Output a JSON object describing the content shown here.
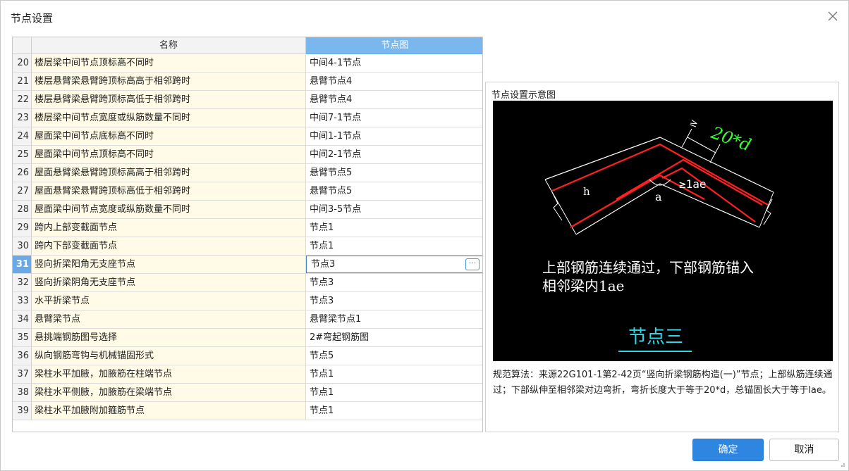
{
  "dialog": {
    "title": "节点设置"
  },
  "table": {
    "col_name": "名称",
    "col_node": "节点图",
    "selected_row": 11,
    "rows": [
      {
        "num": "20",
        "name": "楼层梁中间节点顶标高不同时",
        "node": "中间4-1节点"
      },
      {
        "num": "21",
        "name": "楼层悬臂梁悬臂跨顶标高高于相邻跨时",
        "node": "悬臂节点4"
      },
      {
        "num": "22",
        "name": "楼层悬臂梁悬臂跨顶标高低于相邻跨时",
        "node": "悬臂节点4"
      },
      {
        "num": "23",
        "name": "楼层梁中间节点宽度或纵筋数量不同时",
        "node": "中间7-1节点"
      },
      {
        "num": "24",
        "name": "屋面梁中间节点底标高不同时",
        "node": "中间1-1节点"
      },
      {
        "num": "25",
        "name": "屋面梁中间节点顶标高不同时",
        "node": "中间2-1节点"
      },
      {
        "num": "26",
        "name": "屋面悬臂梁悬臂跨顶标高高于相邻跨时",
        "node": "悬臂节点5"
      },
      {
        "num": "27",
        "name": "屋面悬臂梁悬臂跨顶标高低于相邻跨时",
        "node": "悬臂节点5"
      },
      {
        "num": "28",
        "name": "屋面梁中间节点宽度或纵筋数量不同时",
        "node": "中间3-5节点"
      },
      {
        "num": "29",
        "name": "跨内上部变截面节点",
        "node": "节点1"
      },
      {
        "num": "30",
        "name": "跨内下部变截面节点",
        "node": "节点1"
      },
      {
        "num": "31",
        "name": "竖向折梁阳角无支座节点",
        "node": "节点3"
      },
      {
        "num": "32",
        "name": "竖向折梁阴角无支座节点",
        "node": "节点3"
      },
      {
        "num": "33",
        "name": "水平折梁节点",
        "node": "节点3"
      },
      {
        "num": "34",
        "name": "悬臂梁节点",
        "node": "悬臂梁节点1"
      },
      {
        "num": "35",
        "name": "悬挑端钢筋图号选择",
        "node": "2#弯起钢筋图"
      },
      {
        "num": "36",
        "name": "纵向钢筋弯钩与机械锚固形式",
        "node": "节点5"
      },
      {
        "num": "37",
        "name": "梁柱水平加腋，加腋筋在柱端节点",
        "node": "节点1"
      },
      {
        "num": "38",
        "name": "梁柱水平侧腋，加腋筋在梁端节点",
        "node": "节点1"
      },
      {
        "num": "39",
        "name": "梁柱水平加腋附加箍筋节点",
        "node": "节点1"
      }
    ],
    "more_label": "···"
  },
  "preview": {
    "title": "节点设置示意图",
    "dim_label": "20*d",
    "lae_label": "≥1ae",
    "h_label": "h",
    "a_label": "a",
    "caption_line1": "上部钢筋连续通过，下部钢筋锚入",
    "caption_line2": "相邻梁内1ae",
    "node_title": "节点三",
    "description": "规范算法：来源22G101-1第2-42页“竖向折梁钢筋构造(一)”节点；上部纵筋连续通过；下部纵伸至相邻梁对边弯折，弯折长度大于等于20*d，总锚固长大于等于lae。"
  },
  "buttons": {
    "ok": "确定",
    "cancel": "取消"
  }
}
